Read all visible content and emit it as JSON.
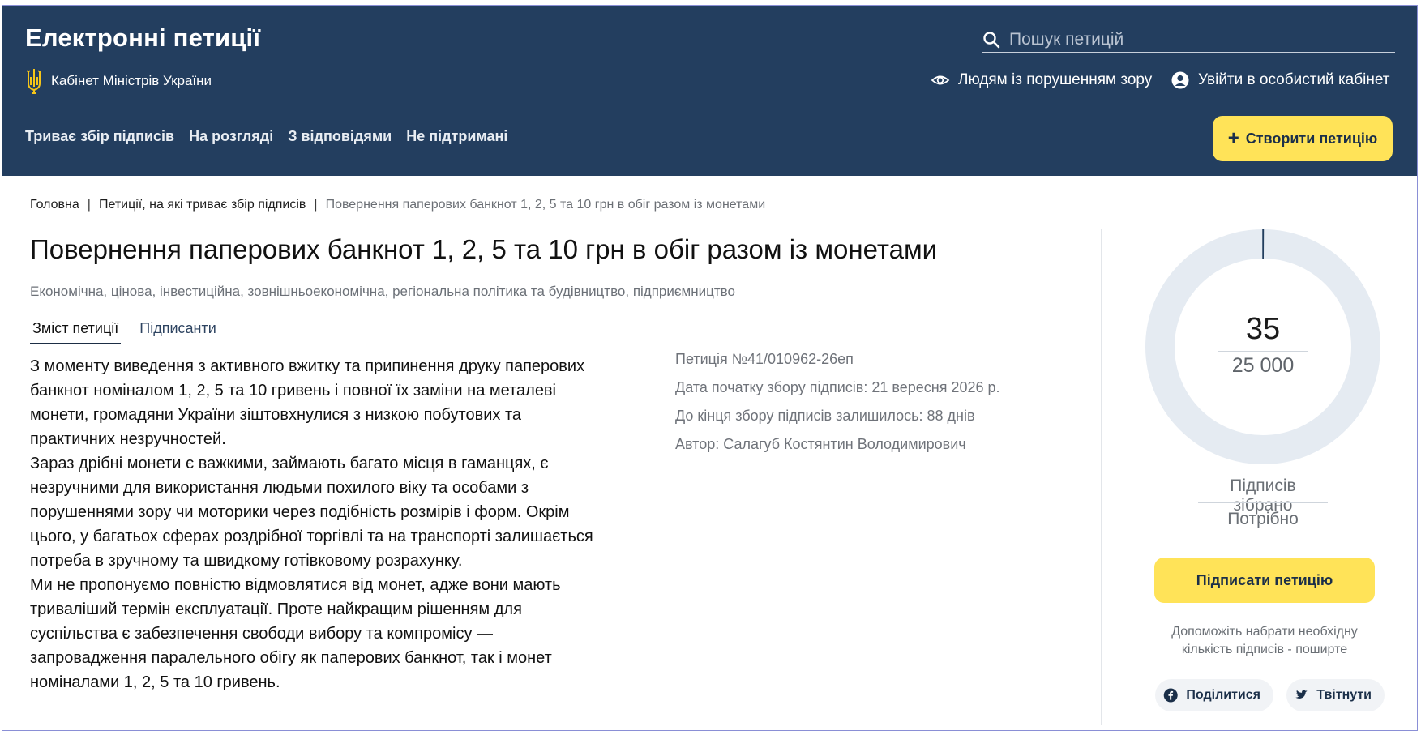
{
  "header": {
    "site_title": "Електронні петиції",
    "gov_name": "Кабінет Міністрів України",
    "search_placeholder": "Пошук петицій",
    "vision_label": "Людям із порушенням зору",
    "login_label": "Увійти в особистий кабінет",
    "nav": [
      "Триває збір підписів",
      "На розгляді",
      "З відповідями",
      "Не підтримані"
    ],
    "create_button": "Створити петицію"
  },
  "breadcrumb": {
    "home": "Головна",
    "section": "Петиції, на які триває збір підписів",
    "current": "Повернення паперових банкнот 1, 2, 5 та 10 грн в обіг разом із монетами"
  },
  "petition": {
    "title": "Повернення паперових банкнот 1, 2, 5 та 10 грн в обіг разом із монетами",
    "categories": "Економічна, цінова, інвестиційна, зовнішньоекономічна, регіональна політика та будівництво, підприємництво",
    "tabs": [
      "Зміст петиції",
      "Підписанти"
    ],
    "text_lines": [
      "З моменту виведення з активного вжитку та припинення друку паперових",
      "банкнот номіналом 1, 2, 5 та 10 гривень і повної їх заміни на металеві",
      "монети, громадяни України зіштовхнулися з низкою побутових та",
      "практичних незручностей.",
      "Зараз дрібні монети є важкими, займають багато місця в гаманцях, є",
      "незручними для використання людьми похилого віку та особами з",
      "порушеннями зору чи моторики через подібність розмірів і форм. Окрім",
      "цього, у багатьох сферах роздрібної торгівлі та на транспорті залишається",
      "потреба в зручному та швидкому готівковому розрахунку.",
      "Ми не пропонуємо повністю відмовлятися від монет, адже вони мають",
      "триваліший термін експлуатації. Проте найкращим рішенням для",
      "суспільства є забезпечення свободи вибору та компромісу —",
      "запровадження паралельного обігу як паперових банкнот, так і монет",
      "номіналами 1, 2, 5 та 10 гривень."
    ],
    "number": "Петиція №41/010962-26еп",
    "start_date": "Дата початку збору підписів: 21 вересня 2026 р.",
    "days_left": "До кінця збору підписів залишилось: 88 днів",
    "author": "Автор: Салагуб Костянтин Володимирович"
  },
  "signatures": {
    "collected": "35",
    "required": "25 000",
    "collected_value": 35,
    "required_value": 25000,
    "collected_label": "Підписів зібрано",
    "required_label": "Потрібно",
    "sign_button": "Підписати петицію",
    "help_text": "Допоможіть набрати необхідну кількість підписів - поширте",
    "share_facebook": "Поділитися",
    "share_twitter": "Твітнути"
  },
  "colors": {
    "header_bg": "#233e5f",
    "accent_yellow": "#ffe358",
    "donut_track": "#e5ebf2",
    "donut_progress": "#233e5f"
  }
}
